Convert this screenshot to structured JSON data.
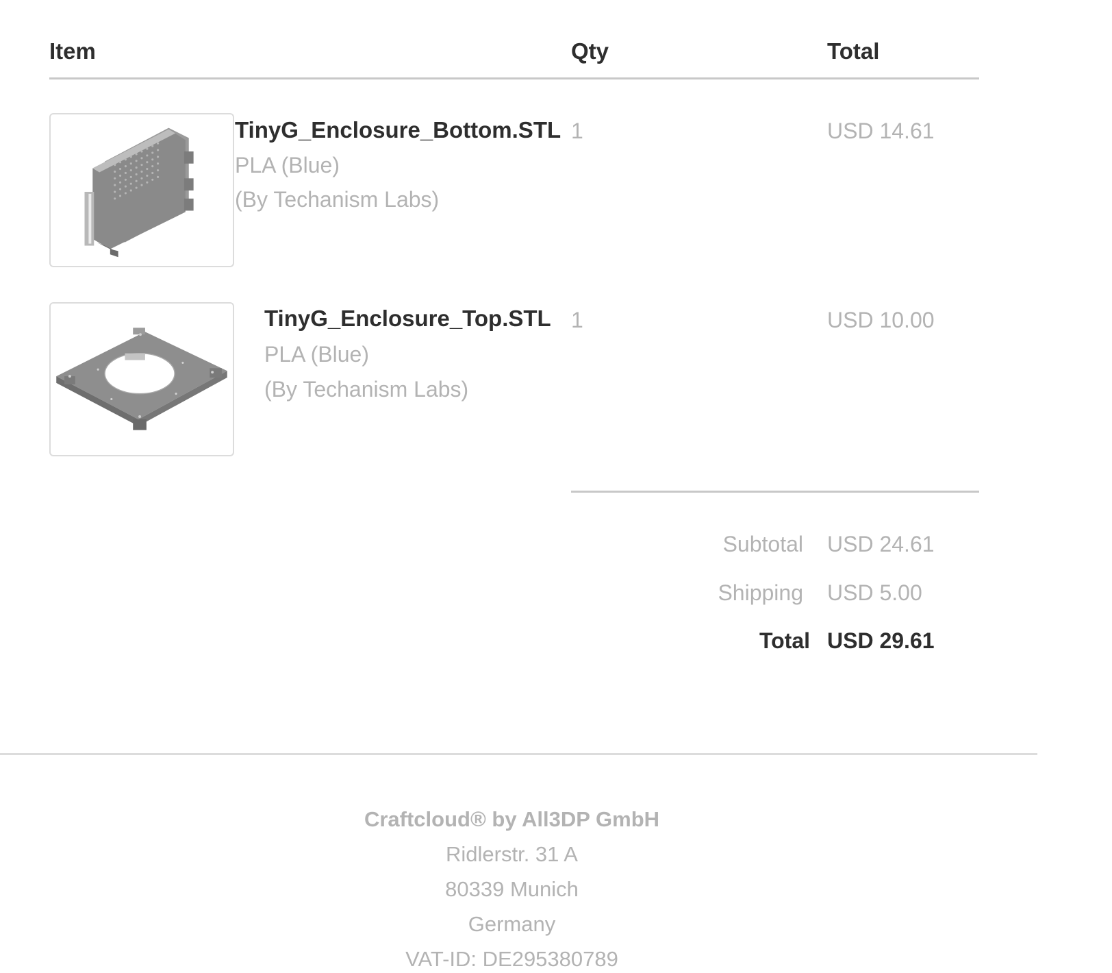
{
  "header": {
    "item_label": "Item",
    "qty_label": "Qty",
    "total_label": "Total"
  },
  "items": [
    {
      "name": "TinyG_Enclosure_Bottom.STL",
      "material": "PLA (Blue)",
      "maker": "(By Techanism Labs)",
      "qty": "1",
      "total": "USD 14.61",
      "thumbnail_icon": "enclosure-bottom-model-icon"
    },
    {
      "name": "TinyG_Enclosure_Top.STL",
      "material": "PLA (Blue)",
      "maker": "(By Techanism Labs)",
      "qty": "1",
      "total": "USD 10.00",
      "thumbnail_icon": "enclosure-top-model-icon"
    }
  ],
  "summary": {
    "subtotal_label": "Subtotal",
    "subtotal_value": "USD 24.61",
    "shipping_label": "Shipping",
    "shipping_value": "USD 5.00",
    "total_label": "Total",
    "total_value": "USD 29.61"
  },
  "footer": {
    "company": "Craftcloud® by All3DP GmbH",
    "street": "Ridlerstr. 31 A",
    "city": "80339 Munich",
    "country": "Germany",
    "vat": "VAT-ID: DE295380789"
  },
  "colors": {
    "text_dark": "#2e2e2e",
    "text_muted": "#b3b3b3",
    "rule": "#c8c8c8",
    "thumb_border": "#dcdcdc"
  }
}
